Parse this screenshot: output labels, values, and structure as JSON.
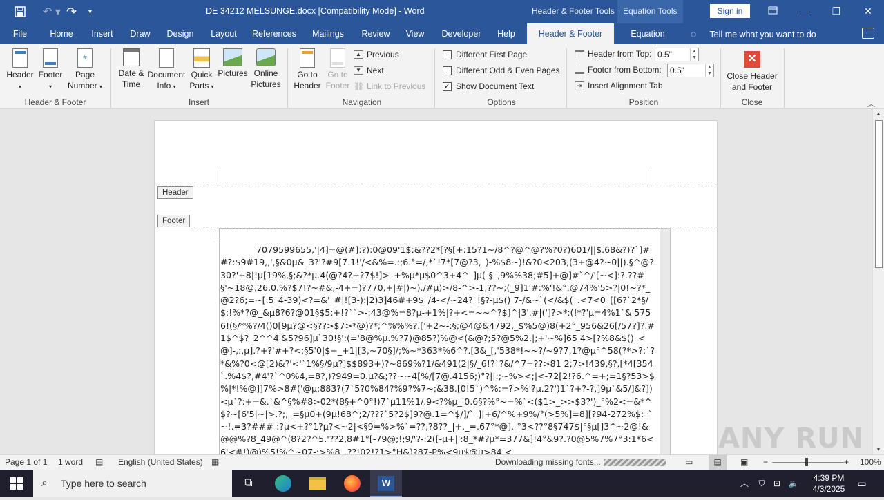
{
  "window": {
    "doc_title": "DE 34212 MELSUNGE.docx [Compatibility Mode]  -  Word",
    "contextual_tabs": [
      "Header & Footer Tools",
      "Equation Tools"
    ],
    "sign_in": "Sign in"
  },
  "tabs": [
    "File",
    "Home",
    "Insert",
    "Draw",
    "Design",
    "Layout",
    "References",
    "Mailings",
    "Review",
    "View",
    "Developer",
    "Help",
    "Header & Footer",
    "Equation"
  ],
  "tell_me": "Tell me what you want to do",
  "ribbon": {
    "hf_group": {
      "header": "Header",
      "footer": "Footer",
      "page_number": "Page Number",
      "label": "Header & Footer"
    },
    "insert_group": {
      "date_time": "Date & Time",
      "document_info": "Document Info",
      "quick_parts": "Quick Parts",
      "pictures": "Pictures",
      "online_pictures": "Online Pictures",
      "label": "Insert"
    },
    "nav_group": {
      "goto_header": "Go to Header",
      "goto_footer": "Go to Footer",
      "previous": "Previous",
      "next": "Next",
      "link_previous": "Link to Previous",
      "label": "Navigation"
    },
    "options_group": {
      "diff_first": "Different First Page",
      "diff_odd_even": "Different Odd & Even Pages",
      "show_doc_text": "Show Document Text",
      "label": "Options"
    },
    "position_group": {
      "header_from_top": "Header from Top:",
      "header_from_top_value": "0.5\"",
      "footer_from_bottom": "Footer from Bottom:",
      "footer_from_bottom_value": "0.5\"",
      "insert_alignment_tab": "Insert Alignment Tab",
      "label": "Position"
    },
    "close_group": {
      "close_hf": "Close Header and Footer",
      "label": "Close"
    }
  },
  "page": {
    "header_tag": "Header",
    "footer_tag": "Footer",
    "body_text": "7079599655,'|4]=@(#]:?):0@09'1$:&??2*[?§[+:15?1~/8^?@^@?%?0?)601/||$.68&?)?`]##?:$9#19,,',§&0µ&_3?'?#9[7.1!'/<&%=.:;6.°=/,*`!7*[7@?3,_)-%$8~)!&?0<203,(3+@4?~0||).§^@?30?'+8|!µ[19%,§;&?*µ.4(@?4?+?7$!]>_+%µ*µ$0^3+4^_]µ(-§_,9%%38;#5]+@]#`^/'[~<]:?.??#§'~18@,26,0.%?$7!?~#&,-4+=)?770,+|#|)~)./#µ)>/8-^>-1,??~;(_9]1'#:%'!&°:@74%'5>?|0!~?*_@2?6;=~[.5_4-39)<?=&'_#|![3-):|2)3]46#+9$_/4-</~24?_!§?-µ$()|7-/&~`(</&$(_.<7<0_[[6?`2*§/$:!%*?@_&µ8?6?@01§$5:+!?``>-:43@%=8?µ-+1%|?+<=~~^?$]^|3'.#|(']?>*:(!*?'µ=4%1`&'5756!(§/*%?/4()0[9µ?@<§??>$7>*@)?*;^%%%?.['+2~-:§;@4@&4792,_$%5@)8(+2°_956&26[/57?]?.#1$^$?_2^^4'&5?96]µ`30!§':(='8@%µ.%?7)@85?)%@<(&@?;5?@5%2.|;+'~%]65 4>[?%8&$()_<@]-,:,µ].?+?'#+?<;§5'0|$+_+1|[3,~70§]/;%~*363*%6^?.[3&_[,'538*!~~?/~9?7,1?@µ°^58(?*>?:`?*&%?0<@[2)&?'<'`1%§/9µ?]$$893+)?~869%?1/&491(2|§/_6!?`?&/^7=??>81 2;7>!439,§?,[*4[354`.%4$?,#4'?`^0%4,=8?,)?949=0.µ?&;??~~4[%/[7@.4156;)°?||:;~%><;|<-72[2!?6.^=+;=1§?53>$%|*!%@]]7%>8#('@µ;883?(7`5?0%84?%9?%7~;&38.[0!5`)^%:=?>%'?µ.2?')1`?+?-?,]9µ`&5/]&?])<µ`?:+=&.`&^§%#8>02*(8§+^0°!)7`µ11%1/.9<?%µ_'0.6§?%°~=%`<($1>_>>$3?')_°%2<=&*^$?~[6'5|~|>.?;,_=§µ0+(9µ!68^;2/???`5?2$]9?@.1=^$/]/`_]|+6/^%+9%/°(>5%]=8][?94-272%$:_`~!.=3?###-:?µ<+?°1?µ?<~2|<§9=%>%`=??,?8??_|+._=.67°*@].-°3<??°8§747$|°§µ[]3^~2@!&@@%?8_49@^(8?2?^5.'??2,8#1°[-79@;!;9/'?-:2([-µ+|':8_*#?µ*=377&]!4°&9?.?0@5%7%7°3:1*6<6'<#!)@)%5!%^~07-:>%8_.??!02!?1>°H&)?87-P%<9µ$@µ>84.<"
  },
  "status": {
    "page": "Page 1 of 1",
    "words": "1 word",
    "language": "English (United States)",
    "downloading": "Downloading missing fonts...",
    "zoom": "100%"
  },
  "taskbar": {
    "search_placeholder": "Type here to search",
    "time": "4:39 PM",
    "date": "4/3/2025"
  },
  "watermark": "ANY RUN"
}
